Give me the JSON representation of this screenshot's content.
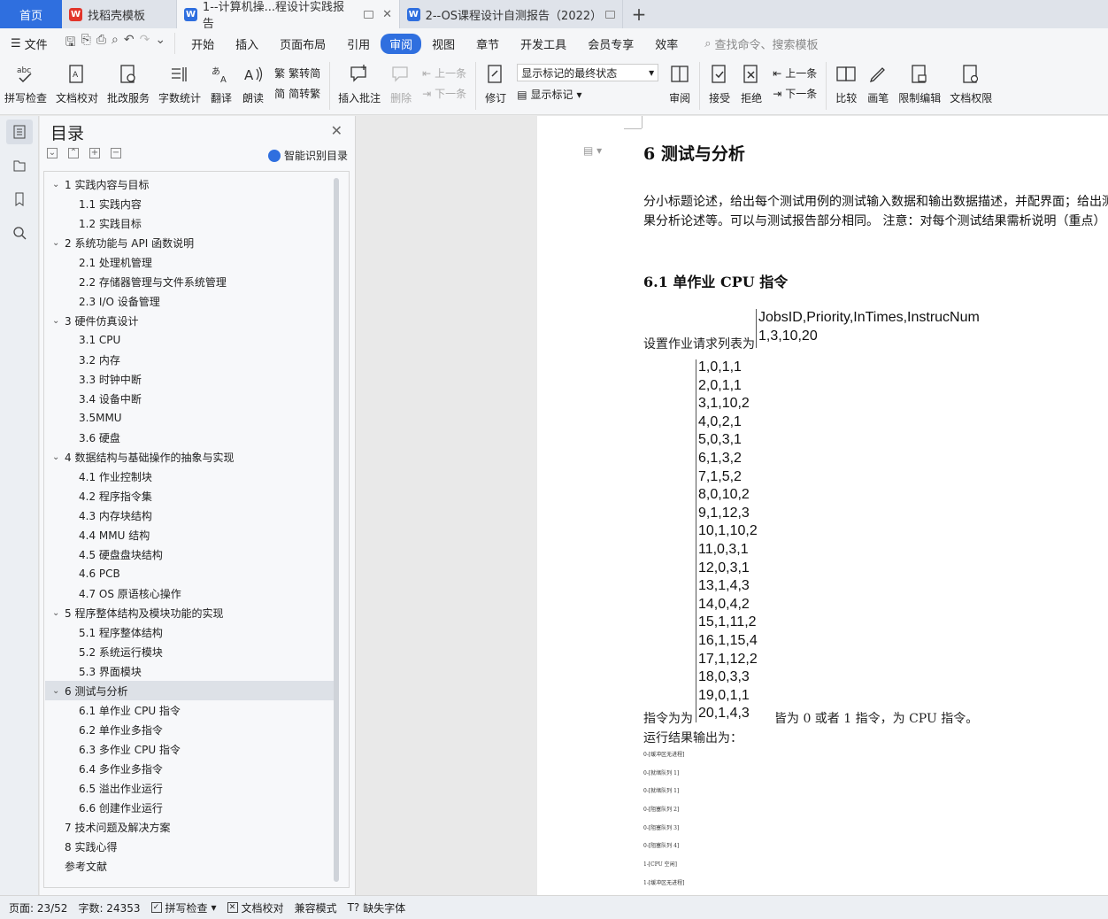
{
  "tabs": {
    "home": "首页",
    "t1": "找稻壳模板",
    "t2": "1--计算机操...程设计实践报告",
    "t3": "2--OS课程设计自测报告（2022）"
  },
  "menu": {
    "file": "文件",
    "items": [
      "开始",
      "插入",
      "页面布局",
      "引用",
      "审阅",
      "视图",
      "章节",
      "开发工具",
      "会员专享",
      "效率"
    ],
    "search": "查找命令、搜索模板"
  },
  "ribbon": {
    "spell": "拼写检查",
    "doccheck": "文档校对",
    "review_service": "批改服务",
    "wordcount": "字数统计",
    "translate": "翻译",
    "read": "朗读",
    "to_trad": "繁转简",
    "to_simp": "简转繁",
    "insert_comment": "插入批注",
    "delete": "删除",
    "prev": "上一条",
    "next": "下一条",
    "revise": "修订",
    "markup_state": "显示标记的最终状态",
    "show_markup": "显示标记",
    "review": "审阅",
    "accept": "接受",
    "reject": "拒绝",
    "prev2": "上一条",
    "next2": "下一条",
    "compare": "比较",
    "pen": "画笔",
    "restrict": "限制编辑",
    "doc_perm": "文档权限"
  },
  "toc": {
    "title": "目录",
    "smart": "智能识别目录",
    "items": [
      {
        "text": "1  实践内容与目标",
        "level": 1
      },
      {
        "text": "1.1 实践内容",
        "level": 2
      },
      {
        "text": "1.2 实践目标",
        "level": 2
      },
      {
        "text": "2  系统功能与  API  函数说明",
        "level": 1
      },
      {
        "text": "2.1 处理机管理",
        "level": 2
      },
      {
        "text": "2.2  存储器管理与文件系统管理",
        "level": 2
      },
      {
        "text": "2.3 I/O 设备管理",
        "level": 2
      },
      {
        "text": "3  硬件仿真设计",
        "level": 1
      },
      {
        "text": "3.1 CPU",
        "level": 2
      },
      {
        "text": "3.2 内存",
        "level": 2
      },
      {
        "text": "3.3 时钟中断",
        "level": 2
      },
      {
        "text": "3.4 设备中断",
        "level": 2
      },
      {
        "text": "3.5MMU",
        "level": 2
      },
      {
        "text": "3.6 硬盘",
        "level": 2
      },
      {
        "text": "4  数据结构与基础操作的抽象与实现",
        "level": 1
      },
      {
        "text": "4.1  作业控制块",
        "level": 2
      },
      {
        "text": "4.2  程序指令集",
        "level": 2
      },
      {
        "text": "4.3  内存块结构",
        "level": 2
      },
      {
        "text": "4.4    MMU 结构",
        "level": 2
      },
      {
        "text": "4.5  硬盘盘块结构",
        "level": 2
      },
      {
        "text": "4.6 PCB",
        "level": 2
      },
      {
        "text": "4.7 OS 原语核心操作",
        "level": 2
      },
      {
        "text": "5  程序整体结构及模块功能的实现",
        "level": 1
      },
      {
        "text": "5.1  程序整体结构",
        "level": 2
      },
      {
        "text": "5.2  系统运行模块",
        "level": 2
      },
      {
        "text": "5.3  界面模块",
        "level": 2
      },
      {
        "text": "6  测试与分析",
        "level": 1,
        "selected": true
      },
      {
        "text": "6.1  单作业 CPU 指令",
        "level": 2
      },
      {
        "text": "6.2  单作业多指令",
        "level": 2
      },
      {
        "text": "6.3  多作业 CPU 指令",
        "level": 2
      },
      {
        "text": "6.4  多作业多指令",
        "level": 2
      },
      {
        "text": "6.5  溢出作业运行",
        "level": 2
      },
      {
        "text": "6.6  创建作业运行",
        "level": 2
      },
      {
        "text": "7  技术问题及解决方案",
        "level": 1,
        "nocaret": true
      },
      {
        "text": "8  实践心得",
        "level": 1,
        "nocaret": true
      },
      {
        "text": "参考文献",
        "level": 1,
        "nocaret": true
      }
    ]
  },
  "doc": {
    "h1": "6  测试与分析",
    "para": "分小标题论述，给出每个测试用例的测试输入数据和输出数据描述，并配界面；给出测后结果，并对结果分析论述等。可以与测试报告部分相同。 注意：对每个测试结果需析说明（重点）",
    "h2": "6.1  单作业 CPU 指令",
    "label1": "设置作业请求列表为",
    "jobs_head": [
      "JobsID,Priority,InTimes,InstrucNum",
      "1,3,10,20"
    ],
    "jobs_list": [
      "1,0,1,1",
      "2,0,1,1",
      "3,1,10,2",
      "4,0,2,1",
      "5,0,3,1",
      "6,1,3,2",
      "7,1,5,2",
      "8,0,10,2",
      "9,1,12,3",
      "10,1,10,2",
      "11,0,3,1",
      "12,0,3,1",
      "13,1,4,3",
      "14,0,4,2",
      "15,1,11,2",
      "16,1,15,4",
      "17,1,12,2",
      "18,0,3,3",
      "19,0,1,1",
      "20,1,4,3"
    ],
    "label2": "指令为为",
    "label2b": "皆为 0 或者 1 指令，为 CPU 指令。",
    "label3": "运行结果输出为：",
    "output": [
      "0-[缓冲区无进程]",
      "0-[就绪队列 1]",
      "0-[就绪队列 1]",
      "0-[阻塞队列 2]",
      "0-[阻塞队列 3]",
      "0-[阻塞队列 4]",
      "1-[CPU 空闲]",
      "1-[缓冲区无进程]"
    ]
  },
  "status": {
    "page": "页面: 23/52",
    "words": "字数: 24353",
    "spell": "拼写检查",
    "check": "文档校对",
    "compat": "兼容模式",
    "font": "缺失字体"
  }
}
